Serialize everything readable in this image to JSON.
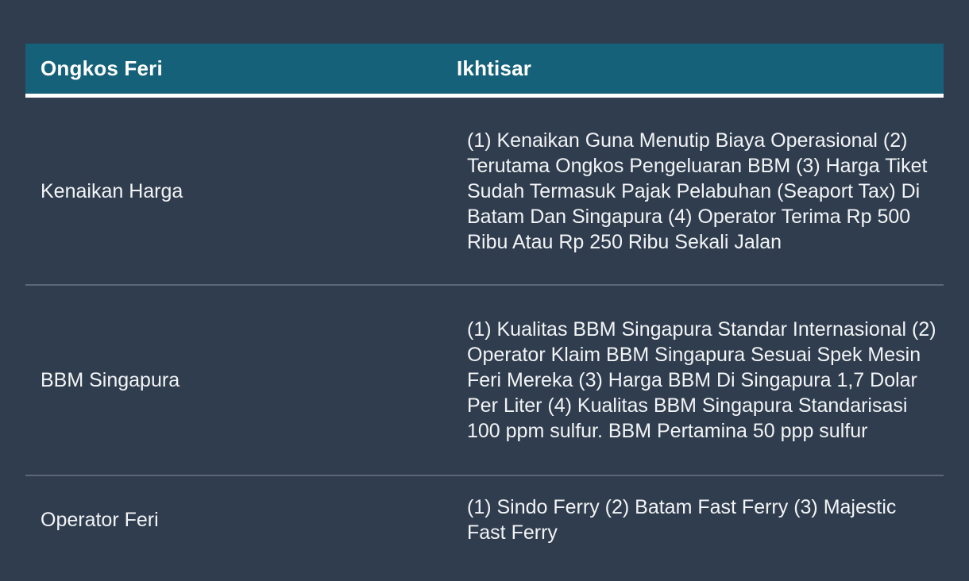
{
  "table": {
    "columns": [
      {
        "key": "topic",
        "label": "Ongkos Feri"
      },
      {
        "key": "summary",
        "label": "Ikhtisar"
      }
    ],
    "rows": [
      {
        "topic": "Kenaikan Harga",
        "summary": "(1) Kenaikan Guna Menutip Biaya Operasional (2) Terutama Ongkos Pengeluaran BBM (3) Harga Tiket Sudah Termasuk Pajak Pelabuhan (Seaport Tax) Di Batam Dan Singapura (4) Operator Terima Rp 500 Ribu Atau Rp 250 Ribu Sekali Jalan"
      },
      {
        "topic": "BBM Singapura",
        "summary": "(1) Kualitas BBM Singapura Standar Internasional (2) Operator Klaim BBM Singapura Sesuai Spek Mesin Feri Mereka (3) Harga BBM Di Singapura 1,7 Dolar Per Liter (4) Kualitas BBM Singapura Standarisasi 100 ppm sulfur. BBM Pertamina 50 ppp sulfur"
      },
      {
        "topic": "Operator Feri",
        "summary": "(1) Sindo Ferry (2) Batam Fast Ferry (3) Majestic Fast Ferry"
      }
    ]
  },
  "colors": {
    "background": "#303d4e",
    "header_bar": "#16617a",
    "header_underline": "#ffffff",
    "row_divider": "#5b6778",
    "text": "#f2f4f6"
  }
}
